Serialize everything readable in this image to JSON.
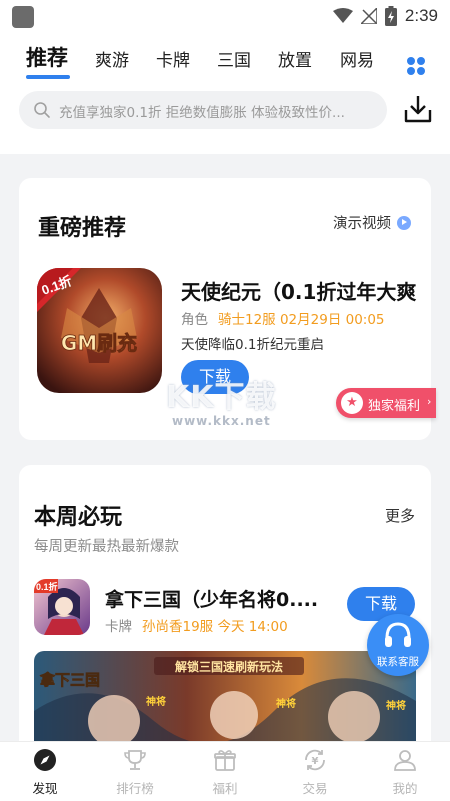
{
  "status_bar": {
    "time": "2:39"
  },
  "tabs": [
    {
      "label": "推荐",
      "active": true
    },
    {
      "label": "爽游"
    },
    {
      "label": "卡牌"
    },
    {
      "label": "三国"
    },
    {
      "label": "放置"
    },
    {
      "label": "网易"
    }
  ],
  "search": {
    "placeholder": "充值享独家0.1折 拒绝数值膨胀 体验极致性价..."
  },
  "featured": {
    "title": "重磅推荐",
    "demo_label": "演示视频",
    "game": {
      "name": "天使纪元（0.1折过年大爽",
      "category": "角色",
      "server": "骑士12服 02月29日 00:05",
      "desc": "天使降临0.1折纪元重启",
      "icon_badge": "0.1折",
      "icon_text": "GM刷充",
      "download_label": "下载"
    },
    "welfare_label": "独家福利",
    "watermark": "KK下载",
    "watermark_url": "www.kkx.net"
  },
  "weekly": {
    "title": "本周必玩",
    "more_label": "更多",
    "subtitle": "每周更新最热最新爆款",
    "game": {
      "name": "拿下三国（少年名将0....",
      "category": "卡牌",
      "server": "孙尚香19服 今天 14:00",
      "icon_badge": "0.1折",
      "download_label": "下载"
    },
    "banner": {
      "logo": "拿下三国",
      "slogan": "解锁三国速刷新玩法",
      "tags": [
        "神将",
        "神将",
        "神将"
      ]
    }
  },
  "service_label": "联系客服",
  "bottom_nav": [
    {
      "label": "发现",
      "icon": "compass-icon",
      "active": true
    },
    {
      "label": "排行榜",
      "icon": "trophy-icon"
    },
    {
      "label": "福利",
      "icon": "gift-icon"
    },
    {
      "label": "交易",
      "icon": "exchange-icon"
    },
    {
      "label": "我的",
      "icon": "user-icon"
    }
  ],
  "colors": {
    "accent": "#2f80ed",
    "server": "#f29c1f",
    "welfare": "#f0506a"
  }
}
